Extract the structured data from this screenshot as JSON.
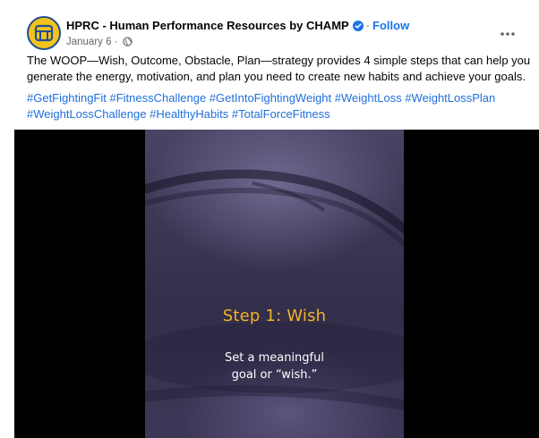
{
  "post": {
    "page_name": "HPRC - Human Performance Resources by CHAMP",
    "separator": "·",
    "follow_label": "Follow",
    "date": "January 6",
    "date_separator": "·",
    "more_icon": "more-horizontal-icon",
    "body_text": "The WOOP—Wish, Outcome, Obstacle, Plan—strategy provides 4 simple steps that can help you generate the energy, motivation, and plan you need to create new habits and achieve your goals.",
    "hashtags": [
      "#GetFightingFit",
      "#FitnessChallenge",
      "#GetIntoFightingWeight",
      "#WeightLoss",
      "#WeightLossPlan",
      "#WeightLossChallenge",
      "#HealthyHabits",
      "#TotalForceFitness"
    ]
  },
  "video": {
    "step_title": "Step 1: Wish",
    "caption_line1": "Set a meaningful",
    "caption_line2": "goal or “wish.”"
  },
  "colors": {
    "link": "#216fdb",
    "follow": "#1b74e4",
    "verified": "#1b74e4",
    "avatar_bg": "#f4c21c",
    "avatar_ring": "#1f4f91",
    "step_title": "#f2b32a",
    "video_bg": "#000000"
  }
}
